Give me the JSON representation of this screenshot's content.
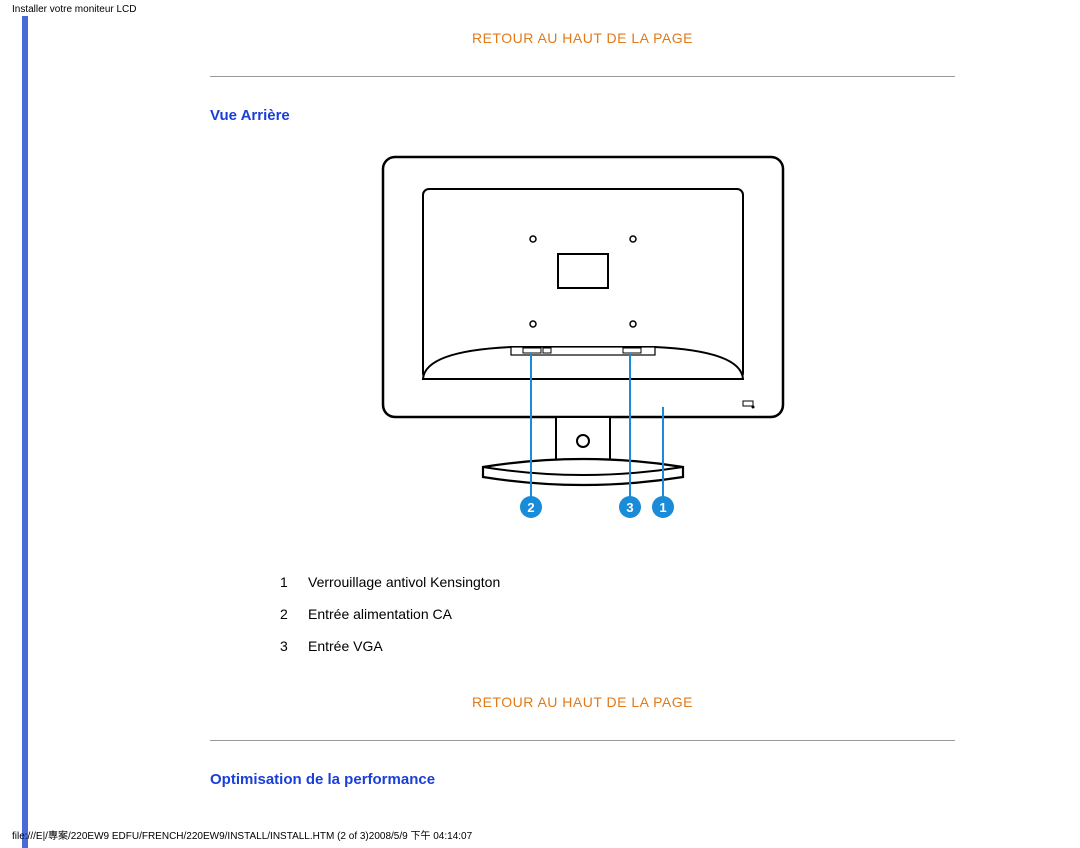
{
  "header": {
    "title": "Installer votre moniteur LCD"
  },
  "links": {
    "back_to_top": "RETOUR AU HAUT DE LA PAGE"
  },
  "sections": {
    "rear_view": "Vue Arrière",
    "perf_opt": "Optimisation de la performance"
  },
  "diagram": {
    "callouts": [
      "2",
      "3",
      "1"
    ]
  },
  "legend": [
    {
      "num": "1",
      "text": "Verrouillage antivol Kensington"
    },
    {
      "num": "2",
      "text": "Entrée alimentation CA"
    },
    {
      "num": "3",
      "text": "Entrée VGA"
    }
  ],
  "footer": {
    "path": "file:///E|/專案/220EW9 EDFU/FRENCH/220EW9/INSTALL/INSTALL.HTM (2 of 3)2008/5/9 下午 04:14:07"
  }
}
